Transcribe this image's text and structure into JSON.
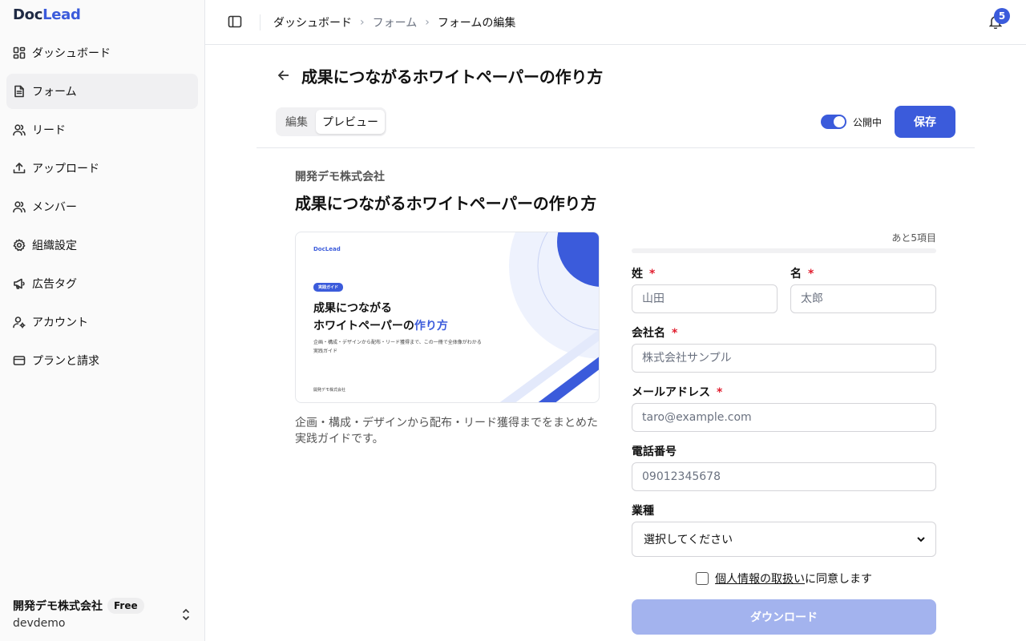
{
  "app": {
    "brand_doc": "Doc",
    "brand_lead": "Lead"
  },
  "sidebar": {
    "items": [
      {
        "label": "ダッシュボード",
        "icon": "dashboard-icon"
      },
      {
        "label": "フォーム",
        "icon": "document-icon",
        "active": true
      },
      {
        "label": "リード",
        "icon": "users-icon"
      },
      {
        "label": "アップロード",
        "icon": "upload-icon"
      },
      {
        "label": "メンバー",
        "icon": "members-icon"
      },
      {
        "label": "組織設定",
        "icon": "gear-icon"
      },
      {
        "label": "広告タグ",
        "icon": "megaphone-icon"
      },
      {
        "label": "アカウント",
        "icon": "user-gear-icon"
      },
      {
        "label": "プランと請求",
        "icon": "credit-card-icon"
      }
    ],
    "org": {
      "name": "開発デモ株式会社",
      "plan": "Free",
      "slug": "devdemo"
    }
  },
  "header": {
    "breadcrumbs": [
      "ダッシュボード",
      "フォーム",
      "フォームの編集"
    ],
    "notifications": "5"
  },
  "page": {
    "title": "成果につながるホワイトペーパーの作り方",
    "tabs": {
      "edit": "編集",
      "preview": "プレビュー",
      "active": "preview"
    },
    "publish_label": "公開中",
    "published": true,
    "save_label": "保存"
  },
  "preview": {
    "company": "開発デモ株式会社",
    "title": "成果につながるホワイトペーパーの作り方",
    "cover": {
      "brand": "DocLead",
      "badge": "実践ガイド",
      "heading_line1": "成果につながる",
      "heading_line2": "ホワイトペーパーの",
      "heading_accent": "作り方",
      "subtitle": "企画・構成・デザインから配布・リード獲得まで、この一冊で全体像がわかる実践ガイド",
      "footer": "開発デモ株式会社"
    },
    "description": "企画・構成・デザインから配布・リード獲得までをまとめた実践ガイドです。"
  },
  "form": {
    "remaining": "あと5項目",
    "progress": 0,
    "last_name": {
      "label": "姓",
      "required": "*",
      "placeholder": "山田"
    },
    "first_name": {
      "label": "名",
      "required": "*",
      "placeholder": "太郎"
    },
    "company": {
      "label": "会社名",
      "required": "*",
      "placeholder": "株式会社サンプル"
    },
    "email": {
      "label": "メールアドレス",
      "required": "*",
      "placeholder": "taro@example.com"
    },
    "phone": {
      "label": "電話番号",
      "placeholder": "09012345678"
    },
    "industry": {
      "label": "業種",
      "value": "選択してください"
    },
    "consent": {
      "link": "個人情報の取扱い",
      "text": "に同意します"
    },
    "submit_label": "ダウンロード"
  },
  "colors": {
    "accent": "#3b5bdb",
    "required": "#e11d2e",
    "disabled_button": "#a3b3ee"
  }
}
